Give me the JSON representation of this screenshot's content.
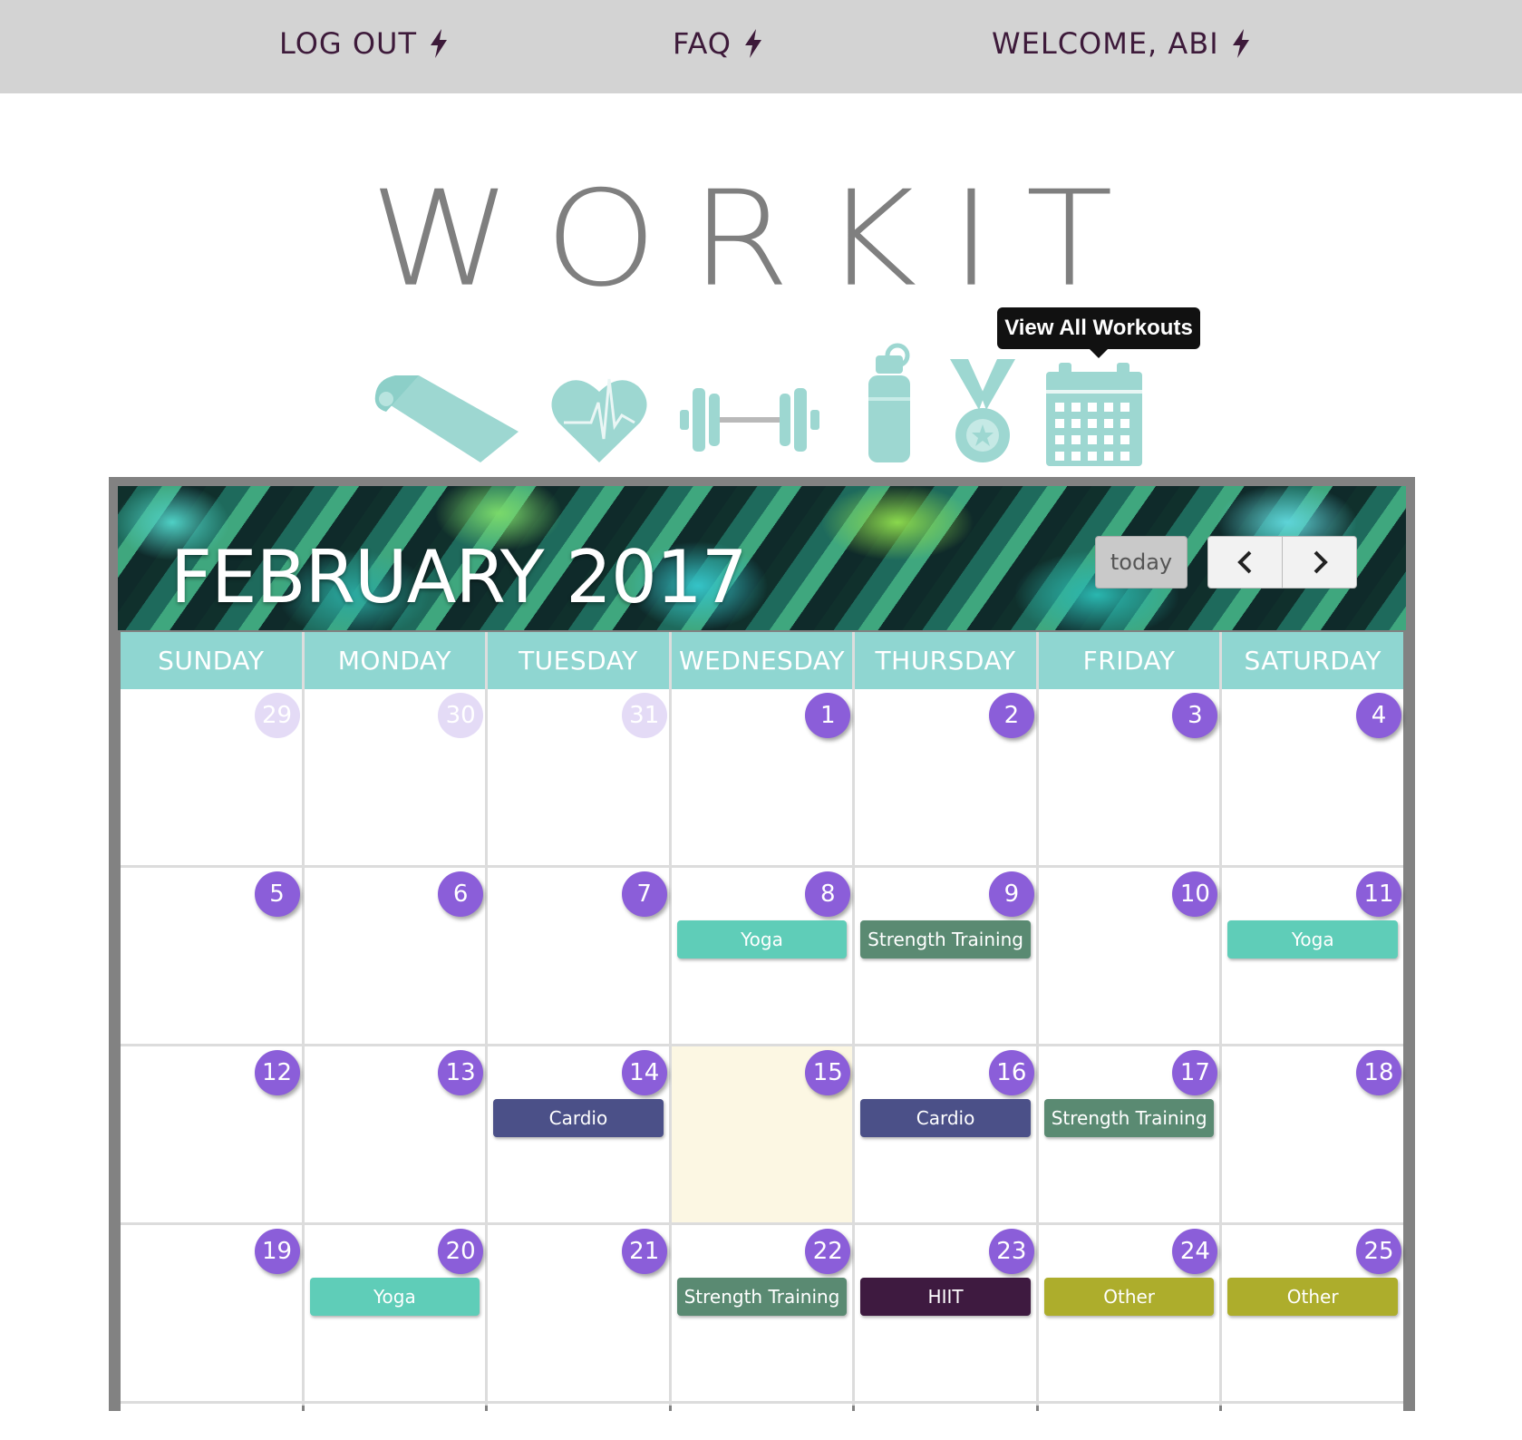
{
  "nav": {
    "logout": "LOG OUT",
    "faq": "FAQ",
    "welcome": "WELCOME, ABI"
  },
  "logo": [
    "W",
    "O",
    "R",
    "K",
    "I",
    "T"
  ],
  "icons": [
    "yoga-mat-icon",
    "heartbeat-icon",
    "dumbbell-icon",
    "water-bottle-icon",
    "medal-icon",
    "calendar-icon"
  ],
  "tooltip": "View All Workouts",
  "calendar": {
    "title": "FEBRUARY 2017",
    "today_button": "today",
    "prev_icon": "chevron-left-icon",
    "next_icon": "chevron-right-icon",
    "weekdays": [
      "SUNDAY",
      "MONDAY",
      "TUESDAY",
      "WEDNESDAY",
      "THURSDAY",
      "FRIDAY",
      "SATURDAY"
    ],
    "weeks": [
      [
        {
          "day": "29",
          "other": true,
          "events": []
        },
        {
          "day": "30",
          "other": true,
          "events": []
        },
        {
          "day": "31",
          "other": true,
          "events": []
        },
        {
          "day": "1",
          "events": []
        },
        {
          "day": "2",
          "events": []
        },
        {
          "day": "3",
          "events": []
        },
        {
          "day": "4",
          "events": []
        }
      ],
      [
        {
          "day": "5",
          "events": []
        },
        {
          "day": "6",
          "events": []
        },
        {
          "day": "7",
          "events": []
        },
        {
          "day": "8",
          "events": [
            {
              "label": "Yoga",
              "type": "yoga"
            }
          ]
        },
        {
          "day": "9",
          "events": [
            {
              "label": "Strength Training",
              "type": "strength"
            }
          ]
        },
        {
          "day": "10",
          "events": []
        },
        {
          "day": "11",
          "events": [
            {
              "label": "Yoga",
              "type": "yoga"
            }
          ]
        }
      ],
      [
        {
          "day": "12",
          "events": []
        },
        {
          "day": "13",
          "events": []
        },
        {
          "day": "14",
          "events": [
            {
              "label": "Cardio",
              "type": "cardio"
            }
          ]
        },
        {
          "day": "15",
          "today": true,
          "events": []
        },
        {
          "day": "16",
          "events": [
            {
              "label": "Cardio",
              "type": "cardio"
            }
          ]
        },
        {
          "day": "17",
          "events": [
            {
              "label": "Strength Training",
              "type": "strength"
            }
          ]
        },
        {
          "day": "18",
          "events": []
        }
      ],
      [
        {
          "day": "19",
          "events": []
        },
        {
          "day": "20",
          "events": [
            {
              "label": "Yoga",
              "type": "yoga"
            }
          ]
        },
        {
          "day": "21",
          "events": []
        },
        {
          "day": "22",
          "events": [
            {
              "label": "Strength Training",
              "type": "strength"
            }
          ]
        },
        {
          "day": "23",
          "events": [
            {
              "label": "HIIT",
              "type": "hiit"
            }
          ]
        },
        {
          "day": "24",
          "events": [
            {
              "label": "Other",
              "type": "other"
            }
          ]
        },
        {
          "day": "25",
          "events": [
            {
              "label": "Other",
              "type": "other"
            }
          ]
        }
      ]
    ]
  },
  "colors": {
    "nav_bg": "#d3d3d3",
    "nav_text": "#3d1a3a",
    "accent_teal": "#8fd6d1",
    "day_circle": "#8b5ed9",
    "yoga": "#5fcdb8",
    "strength": "#5a8a72",
    "cardio": "#4b5088",
    "hiit": "#3e1a40",
    "other": "#adad2c"
  }
}
